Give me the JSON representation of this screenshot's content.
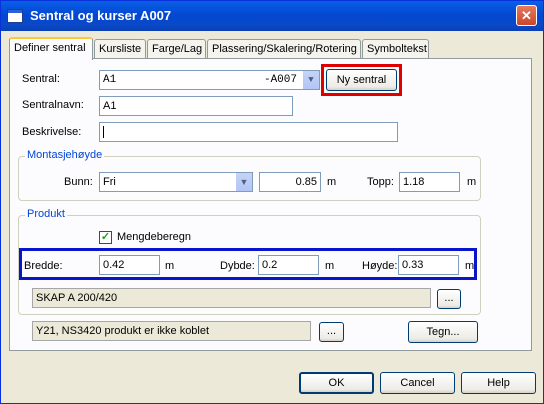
{
  "window": {
    "title": "Sentral og kurser A007",
    "close_glyph": "✕"
  },
  "tabs": [
    {
      "label": "Definer sentral",
      "active": true
    },
    {
      "label": "Kursliste"
    },
    {
      "label": "Farge/Lag"
    },
    {
      "label": "Plassering/Skalering/Rotering"
    },
    {
      "label": "Symboltekst"
    }
  ],
  "sentral": {
    "label": "Sentral:",
    "value": "A1",
    "suffix": "-A007",
    "new_button": "Ny sentral"
  },
  "sentralnavn": {
    "label": "Sentralnavn:",
    "value": "A1"
  },
  "beskrivelse": {
    "label": "Beskrivelse:",
    "value": ""
  },
  "montasje": {
    "title": "Montasjehøyde",
    "bunn_label": "Bunn:",
    "bunn_value": "Fri",
    "bunn_num": "0.85",
    "bunn_unit": "m",
    "topp_label": "Topp:",
    "topp_value": "1.18",
    "topp_unit": "m"
  },
  "produkt": {
    "title": "Produkt",
    "mengde_label": "Mengdeberegn",
    "mengde_checked": true,
    "bredde_label": "Bredde:",
    "bredde_value": "0.42",
    "bredde_unit": "m",
    "dybde_label": "Dybde:",
    "dybde_value": "0.2",
    "dybde_unit": "m",
    "hoyde_label": "Høyde:",
    "hoyde_value": "0.33",
    "hoyde_unit": "m",
    "skap": "SKAP A 200/420",
    "skap_browse": "..."
  },
  "produkt_status": {
    "text": "Y21, NS3420 produkt er ikke koblet",
    "browse": "...",
    "tegn_button": "Tegn..."
  },
  "footer": {
    "ok": "OK",
    "cancel": "Cancel",
    "help": "Help"
  },
  "colors": {
    "highlight_red": "#e00000",
    "highlight_blue": "#0a14c8",
    "group_title": "#0046d5"
  }
}
